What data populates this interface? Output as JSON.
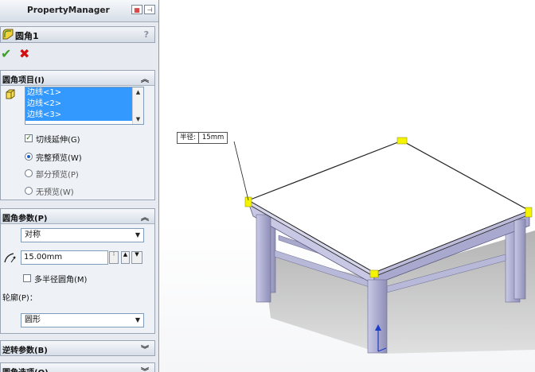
{
  "panel": {
    "title": "PropertyManager",
    "feature_title": "圆角1",
    "help": "?"
  },
  "groups": {
    "fillet_items": {
      "title": "圆角项目(I)",
      "edges": [
        "边线<1>",
        "边线<2>",
        "边线<3>"
      ],
      "tangent_label": "切线延伸(G)",
      "preview_full": "完整预览(W)",
      "preview_partial": "部分预览(P)",
      "preview_none": "无预览(W)"
    },
    "fillet_params": {
      "title": "圆角参数(P)",
      "mode": "对称",
      "radius": "15.00mm",
      "multi_radius_label": "多半径圆角(M)",
      "profile_label": "轮廓(P)：",
      "profile": "圆形"
    },
    "setback": {
      "title": "逆转参数(B)"
    },
    "fillet_options": {
      "title": "圆角选项(O)"
    }
  },
  "callout": {
    "key": "半径:",
    "value": "15mm"
  },
  "colors": {
    "accent": "#3399ff",
    "ok": "#3aa12a",
    "cancel": "#d21010",
    "handle": "#f4f400"
  }
}
